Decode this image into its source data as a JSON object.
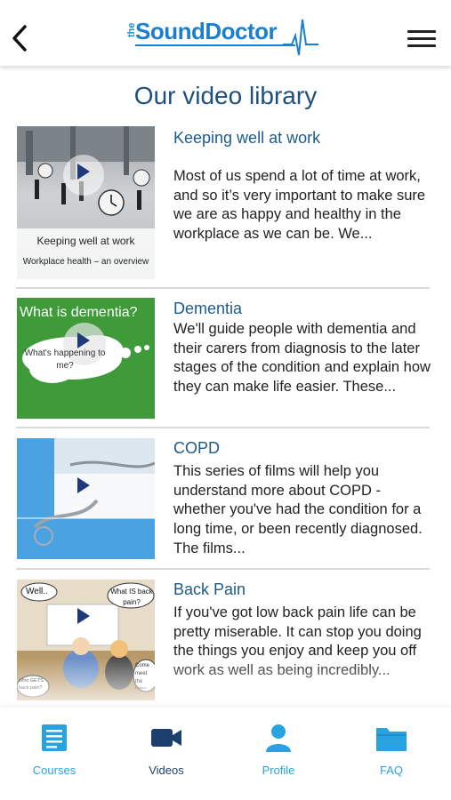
{
  "header": {
    "logo_the": "the",
    "logo_word": "SoundDoctor",
    "back_icon": "chevron-left-icon",
    "menu_icon": "hamburger-icon"
  },
  "page_title": "Our video library",
  "items": [
    {
      "title": "Keeping well at work",
      "description": "Most of us spend a lot of time at work, and so it’s very important to make sure we are as happy and healthy in the workplace as we can be. We...",
      "thumb_caption": "Keeping well at work",
      "thumb_subcaption": "Workplace health – an overview"
    },
    {
      "title": "Dementia",
      "description": "We'll guide people with dementia and their carers from diagnosis to the later stages of the condition and explain how they can make life easier. These...",
      "thumb_caption": "What is dementia?",
      "thumb_bubble": "What's happening to me?"
    },
    {
      "title": "COPD",
      "description": "This series of films will help you understand more about COPD - whether you've had the condition for a long time, or been recently diagnosed. The films..."
    },
    {
      "title": "Back Pain",
      "description": "If you've got low back pain life can be pretty miserable. It can stop you doing the things you enjoy and keep you off work as well as being incredibly...",
      "thumb_bubble_1": "Well..",
      "thumb_bubble_2": "What IS back pain?",
      "thumb_bubble_3": "Come meet the killer",
      "thumb_bubble_4": "Who GETS back pain?"
    }
  ],
  "nav": {
    "courses": "Courses",
    "videos": "Videos",
    "profile": "Profile",
    "faq": "FAQ",
    "active_color": "#1d3f6e",
    "inactive_color": "#29a3e0"
  }
}
